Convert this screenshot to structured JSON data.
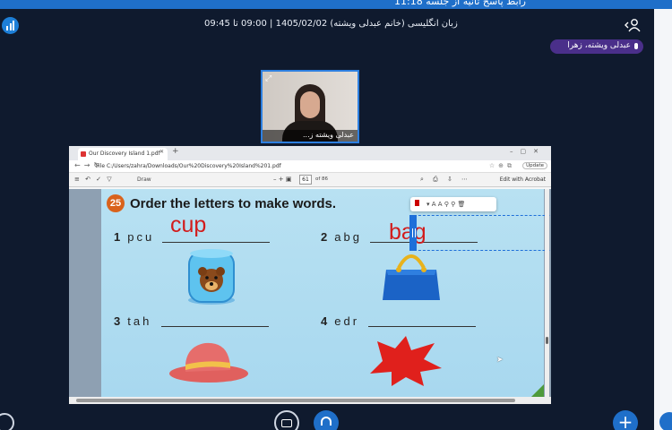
{
  "top_banner": {
    "text": "رابط پاسخ ثانیه از جلسه 11:18"
  },
  "header": {
    "session_title": "زبان انگلیسی (خانم عبدلی ویشته) 1405/02/02 | 09:00 تا 09:45",
    "presenter_name": "عبدلی ویشته، زهرا"
  },
  "camera": {
    "name": "عبدلی ویشته ز..."
  },
  "browser": {
    "tab_title": "Our Discovery Island 1.pdf",
    "url": "C:/Users/zahra/Downloads/Our%20Discovery%20Island%201.pdf",
    "update_label": "Update",
    "file_label": "File"
  },
  "pdf_toolbar": {
    "draw_label": "Draw",
    "page_number": "61",
    "page_total": "of 86",
    "edit_acrobat": "Edit with Acrobat"
  },
  "exercise": {
    "number": "25",
    "title": "Order the letters to make words.",
    "items": [
      {
        "num": "1",
        "letters": "pcu",
        "answer": "cup",
        "picture": "bear-jar"
      },
      {
        "num": "2",
        "letters": "abg",
        "answer": "bag",
        "picture": "blue-bag"
      },
      {
        "num": "3",
        "letters": "tah",
        "answer": "",
        "picture": "red-hat"
      },
      {
        "num": "4",
        "letters": "edr",
        "answer": "",
        "picture": "red-splash"
      }
    ]
  },
  "colors": {
    "answer_ink": "#d21c1c",
    "badge": "#d9621c",
    "accent": "#1f6fc9",
    "presenter_pill": "#4a2f8a"
  }
}
